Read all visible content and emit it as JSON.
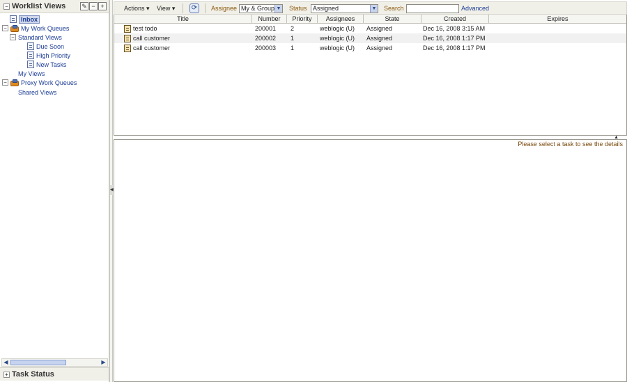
{
  "left_panel": {
    "title": "Worklist Views",
    "header_buttons": [
      "edit",
      "remove",
      "add"
    ],
    "tree": [
      {
        "label": "Inbox",
        "selected": true,
        "icon": "document-icon"
      },
      {
        "label": "My Work Queues",
        "icon": "queue-icon",
        "expander": "−"
      },
      {
        "label": "Standard Views",
        "expander": "−"
      },
      {
        "label": "Due Soon",
        "icon": "document-icon"
      },
      {
        "label": "High Priority",
        "icon": "document-icon"
      },
      {
        "label": "New Tasks",
        "icon": "document-icon"
      },
      {
        "label": "My Views"
      },
      {
        "label": "Proxy Work Queues",
        "icon": "queue-icon",
        "expander": "−"
      },
      {
        "label": "Shared Views"
      }
    ],
    "bottom_title": "Task Status"
  },
  "toolbar": {
    "actions_label": "Actions",
    "view_label": "View",
    "assignee_label": "Assignee",
    "assignee_value": "My & Group",
    "status_label": "Status",
    "status_value": "Assigned",
    "search_label": "Search",
    "search_value": "",
    "advanced_label": "Advanced"
  },
  "table": {
    "columns": [
      "Title",
      "Number",
      "Priority",
      "Assignees",
      "State",
      "Created",
      "Expires"
    ],
    "rows": [
      {
        "title": "test todo",
        "number": "200001",
        "priority": "2",
        "assignees": "weblogic (U)",
        "state": "Assigned",
        "created": "Dec 16, 2008 3:15 AM",
        "expires": ""
      },
      {
        "title": "call customer",
        "number": "200002",
        "priority": "1",
        "assignees": "weblogic (U)",
        "state": "Assigned",
        "created": "Dec 16, 2008 1:17 PM",
        "expires": ""
      },
      {
        "title": "call customer",
        "number": "200003",
        "priority": "1",
        "assignees": "weblogic (U)",
        "state": "Assigned",
        "created": "Dec 16, 2008 1:17 PM",
        "expires": ""
      }
    ]
  },
  "details": {
    "message": "Please select a task to see the details"
  },
  "colors": {
    "link": "#1b3c95",
    "filter_label": "#8a5a10",
    "panel_bg": "#f1f0e8"
  }
}
